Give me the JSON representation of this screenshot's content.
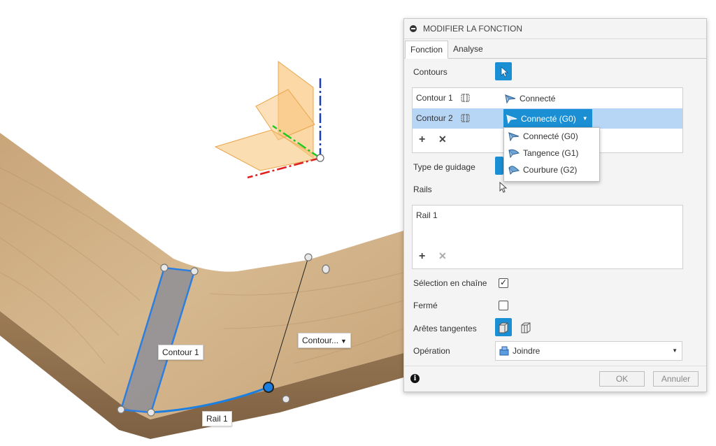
{
  "viewport": {
    "labels": {
      "contour1": "Contour 1",
      "contour2": "Contour...",
      "rail1": "Rail 1"
    }
  },
  "panel": {
    "title": "MODIFIER LA FONCTION",
    "tabs": [
      "Fonction",
      "Analyse"
    ],
    "contours_label": "Contours",
    "contours": [
      {
        "name": "Contour 1",
        "condition": "Connecté"
      },
      {
        "name": "Contour 2",
        "condition": "Connecté (G0)"
      }
    ],
    "condition_options": [
      "Connecté (G0)",
      "Tangence (G1)",
      "Courbure (G2)"
    ],
    "guide_type_label": "Type de guidage",
    "rails_label": "Rails",
    "rails": [
      "Rail 1"
    ],
    "chain_label": "Sélection en chaîne",
    "chain_checked": true,
    "closed_label": "Fermé",
    "closed_checked": false,
    "tangent_edges_label": "Arêtes tangentes",
    "operation_label": "Opération",
    "operation_value": "Joindre",
    "ok_label": "OK",
    "cancel_label": "Annuler"
  },
  "colors": {
    "accent": "#1a8fd4",
    "selected_row": "#b7d6f5",
    "wood": "#c8a67d"
  }
}
